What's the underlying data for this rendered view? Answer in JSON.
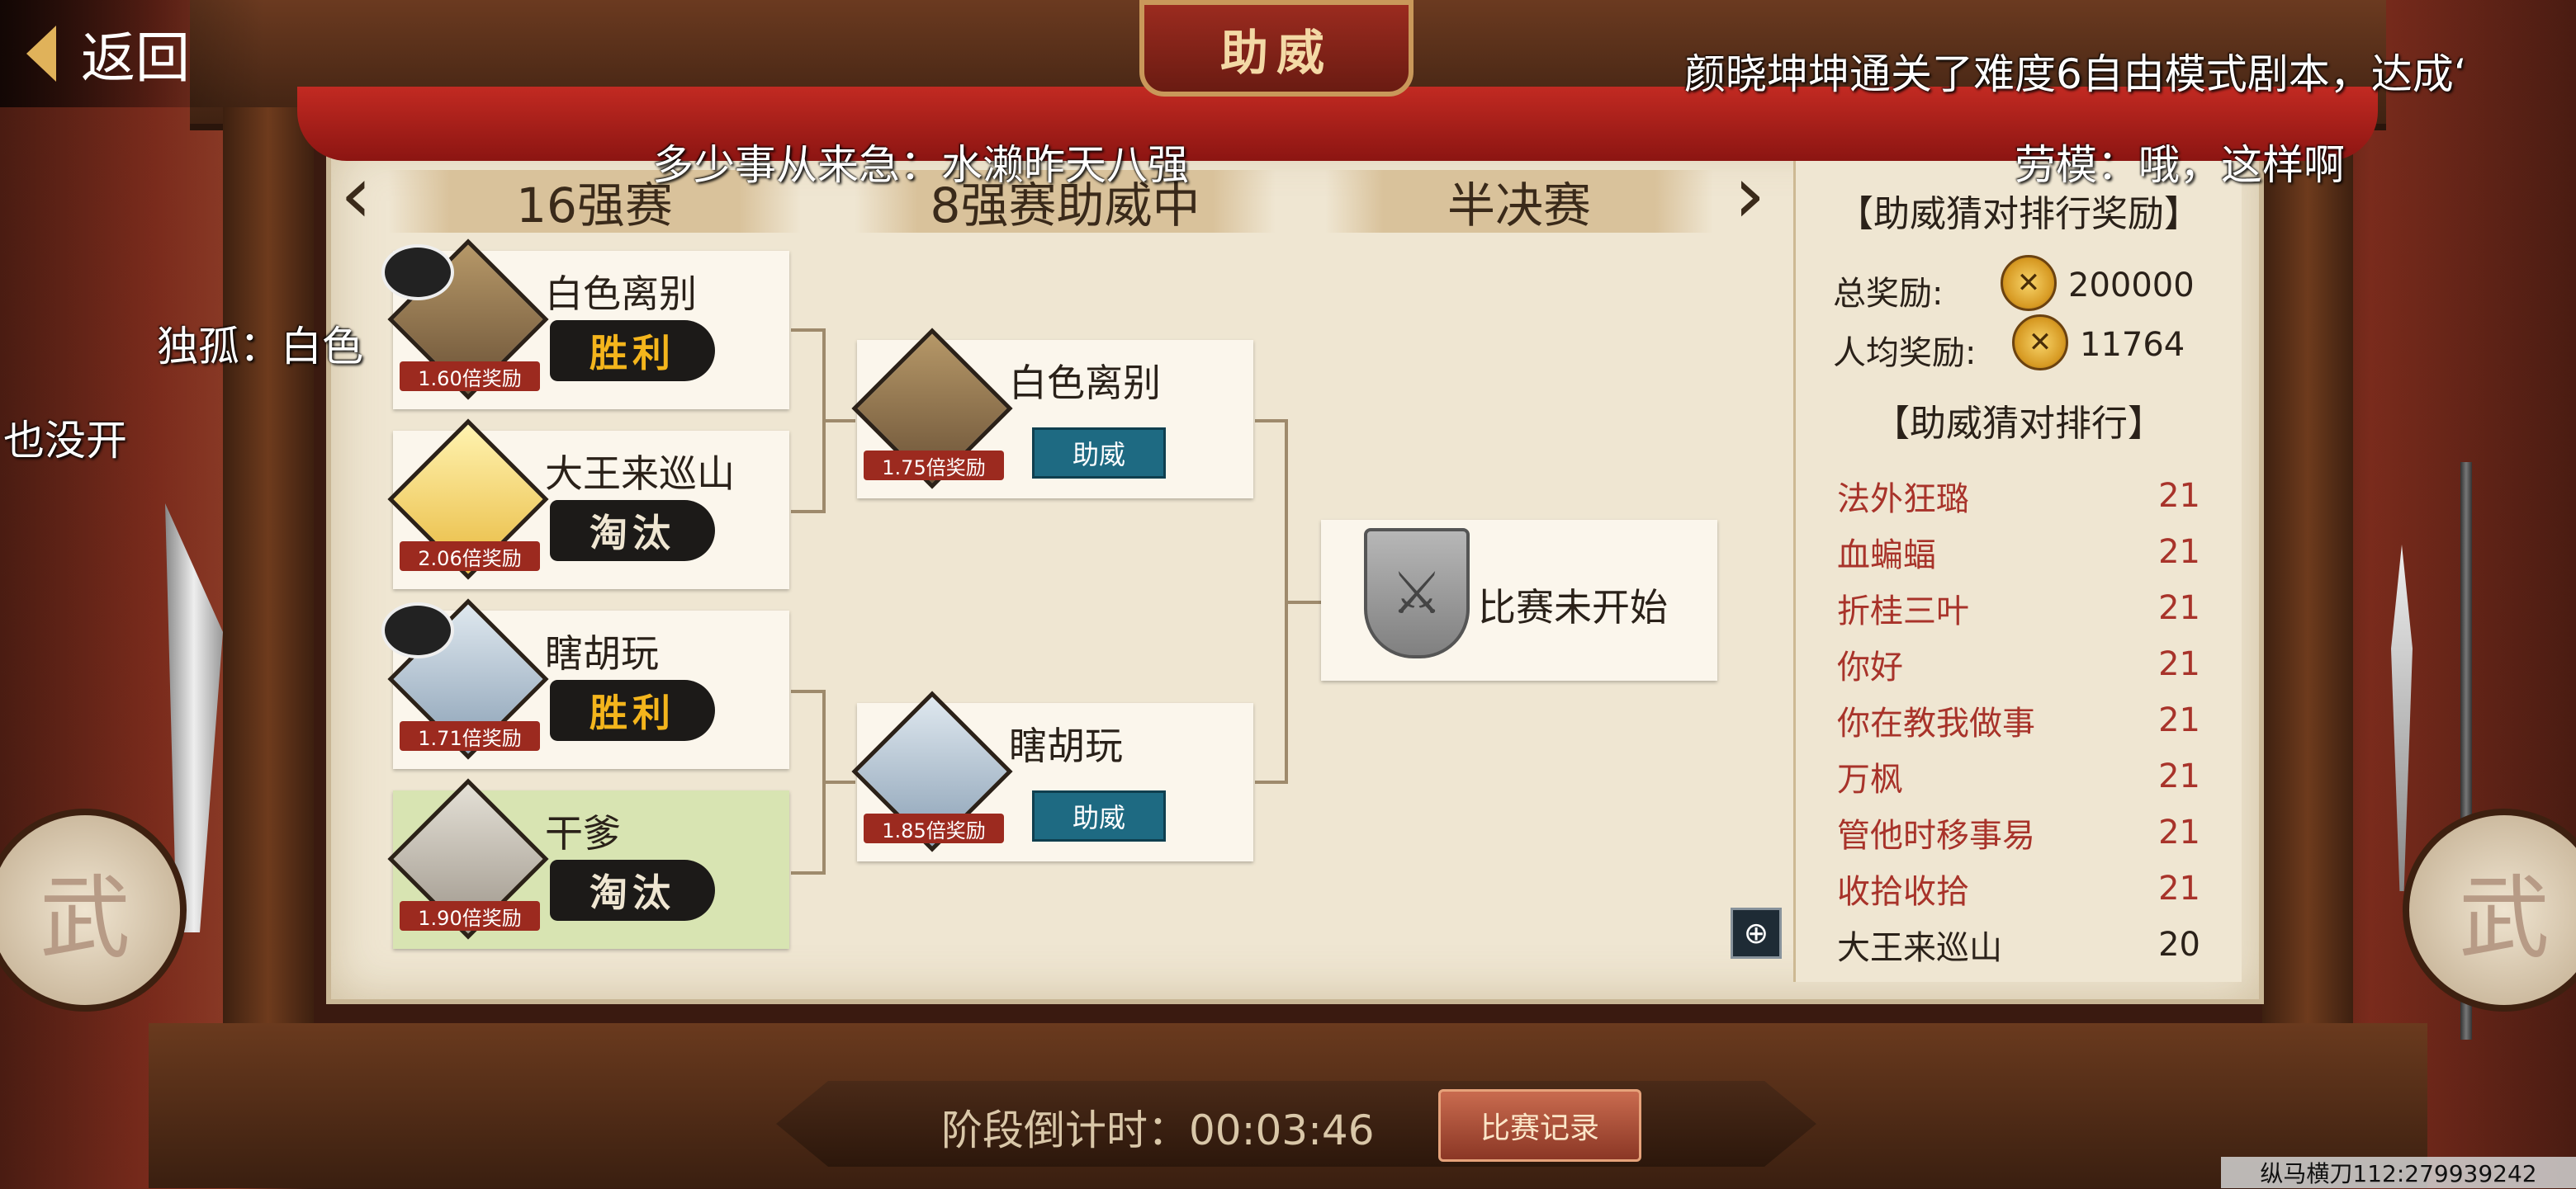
{
  "header": {
    "title_plaque": "助威",
    "back_label": "返回"
  },
  "danmaku": [
    "颜晓坤坤通关了难度6自由模式剧本，达成‘",
    "多少事从来急：水濑昨天八强",
    "劳模：哦，这样啊",
    "独孤：白色",
    "也没开"
  ],
  "rounds": {
    "r16": "16强赛",
    "r8": "8强赛助威中",
    "semi": "半决赛"
  },
  "round_of_16": [
    {
      "name": "白色离别",
      "ratio": "1.60倍奖励",
      "result": "胜利"
    },
    {
      "name": "大王来巡山",
      "ratio": "2.06倍奖励",
      "result": "淘汰"
    },
    {
      "name": "瞎胡玩",
      "ratio": "1.71倍奖励",
      "result": "胜利"
    },
    {
      "name": "干爹",
      "ratio": "1.90倍奖励",
      "result": "淘汰"
    }
  ],
  "round_of_8": [
    {
      "name": "白色离别",
      "ratio": "1.75倍奖励",
      "button": "助威"
    },
    {
      "name": "瞎胡玩",
      "ratio": "1.85倍奖励",
      "button": "助威"
    }
  ],
  "semifinal": {
    "status": "比赛未开始"
  },
  "rewards": {
    "title": "【助威猜对排行奖励】",
    "total_label": "总奖励:",
    "total_value": "200000",
    "per_label": "人均奖励:",
    "per_value": "11764"
  },
  "ranking": {
    "title": "【助威猜对排行】",
    "rows": [
      {
        "name": "法外狂璐",
        "score": "21"
      },
      {
        "name": "血蝙蝠",
        "score": "21"
      },
      {
        "name": "折桂三叶",
        "score": "21"
      },
      {
        "name": "你好",
        "score": "21"
      },
      {
        "name": "你在教我做事",
        "score": "21"
      },
      {
        "name": "万枫",
        "score": "21"
      },
      {
        "name": "管他时移事易",
        "score": "21"
      },
      {
        "name": "收拾收拾",
        "score": "21"
      },
      {
        "name": "大王来巡山",
        "score": "20"
      }
    ]
  },
  "footer": {
    "countdown": "阶段倒计时：00:03:46",
    "record_button": "比赛记录"
  },
  "watermark": "纵马横刀112:279939242",
  "icons": {
    "back": "chevron-left-icon",
    "zoom": "zoom-in-icon",
    "coin": "coin-icon"
  },
  "colors": {
    "win": "#f4b51c",
    "rank_red": "#a8332a",
    "cheer_button": "#1e6a82",
    "curtain": "#c22a22"
  }
}
